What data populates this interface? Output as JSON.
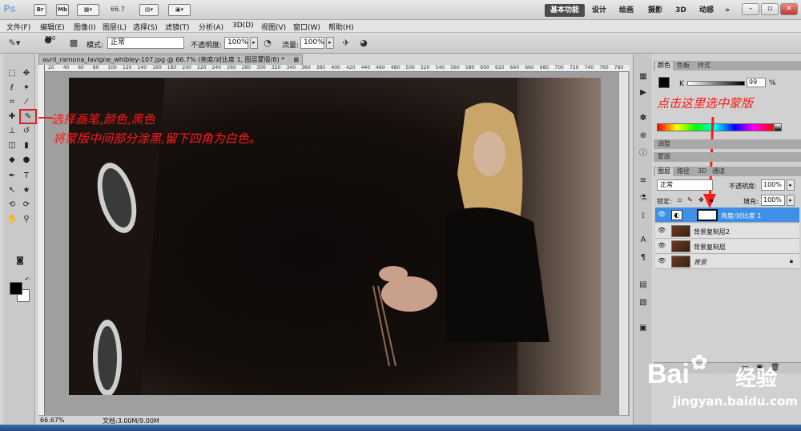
{
  "app": {
    "logo": "Ps",
    "buttons": [
      "Br",
      "Mb"
    ],
    "zoom": "66.7",
    "workspaces": [
      "基本功能",
      "设计",
      "绘画",
      "摄影",
      "3D",
      "动感"
    ],
    "more": "»"
  },
  "menu": [
    "文件(F)",
    "编辑(E)",
    "图像(I)",
    "图层(L)",
    "选择(S)",
    "滤镜(T)",
    "分析(A)",
    "3D(D)",
    "视图(V)",
    "窗口(W)",
    "帮助(H)"
  ],
  "options": {
    "brush_size": "380",
    "mode_label": "模式:",
    "mode_value": "正常",
    "opacity_label": "不透明度:",
    "opacity_value": "100%",
    "flow_label": "流量:",
    "flow_value": "100%"
  },
  "document": {
    "tab_title": "avril_ramona_lavigne_whibley-107.jpg @ 66.7% (亮度/对比度 1, 图层蒙版/8) *",
    "ruler_ticks": [
      "20",
      "40",
      "60",
      "80",
      "100",
      "120",
      "140",
      "160",
      "180",
      "200",
      "220",
      "240",
      "260",
      "280",
      "300",
      "320",
      "340",
      "360",
      "380",
      "400",
      "420",
      "440",
      "460",
      "480",
      "500",
      "520",
      "540",
      "560",
      "580",
      "600",
      "620",
      "640",
      "660",
      "680",
      "700",
      "720",
      "740",
      "760",
      "780"
    ],
    "status_zoom": "66.67%",
    "status_doc": "文档:3.00M/9.00M"
  },
  "panels": {
    "color_tabs": [
      "颜色",
      "色板",
      "样式"
    ],
    "k_label": "K",
    "k_value": "99",
    "k_unit": "%",
    "adjust_tab": "调整",
    "mask_tab": "蒙版",
    "layers_tabs": [
      "图层",
      "路径",
      "3D",
      "通道"
    ],
    "blend_mode": "正常",
    "opacity_label": "不透明度:",
    "opacity_value": "100%",
    "lock_label": "锁定:",
    "fill_label": "填充:",
    "fill_value": "100%",
    "layers": [
      {
        "name": "亮度/对比度 1",
        "selected": true
      },
      {
        "name": "背景复制层2",
        "selected": false
      },
      {
        "name": "背景复制层",
        "selected": false
      },
      {
        "name": "背景",
        "selected": false
      }
    ]
  },
  "annotations": {
    "left_line1": "选择画笔,颜色,黑色",
    "left_line2": "将蒙版中间部分涂黑,留下四角为白色。",
    "right_note": "点击这里选中蒙版"
  },
  "watermark": {
    "brand": "Bai",
    "brand2": "经验",
    "url": "jingyan.baidu.com"
  },
  "colors": {
    "annotation": "#ff1a1a",
    "selection": "#3f8fe6"
  }
}
